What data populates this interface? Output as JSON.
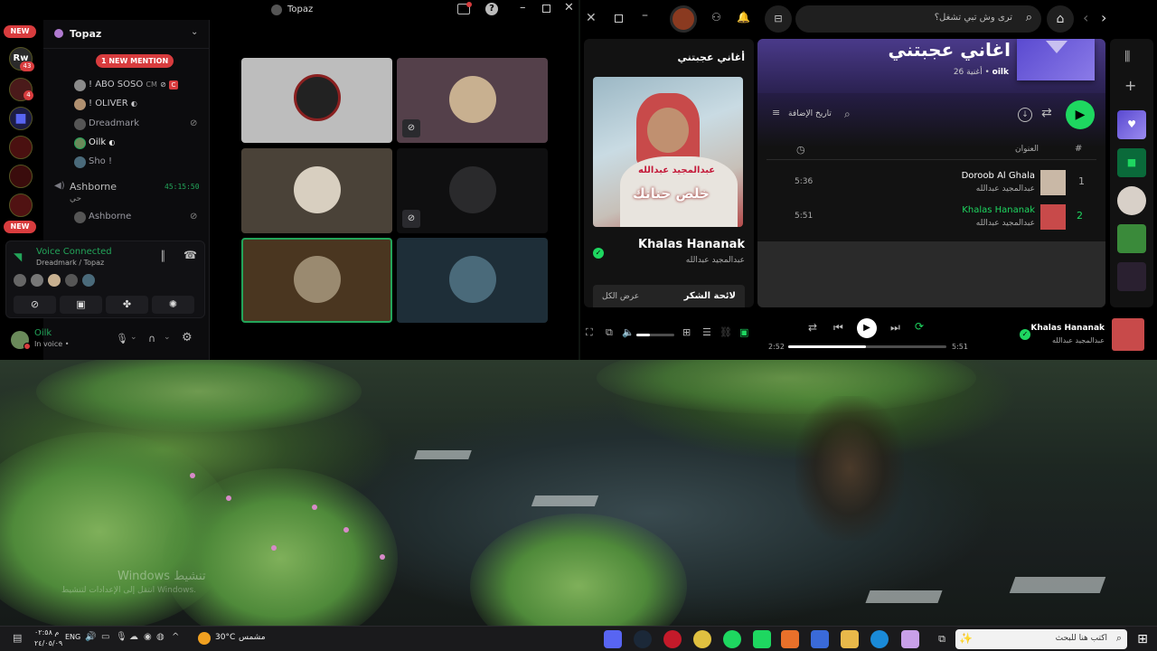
{
  "discord": {
    "window_title": "Topaz",
    "guild_new_badge": "NEW",
    "guild_rw_label": "Rw",
    "guild_badge_count_1": "43",
    "guild_badge_count_2": "4",
    "new_mention": "1 NEW MENTION",
    "server_name": "Topaz",
    "users": [
      {
        "name": "! ABO SOSO",
        "tag": "CM"
      },
      {
        "name": "! OLIVER"
      },
      {
        "name": "Dreadmark"
      },
      {
        "name": "Oilk"
      },
      {
        "name": "Sho !"
      }
    ],
    "channel_name": "Ashborne",
    "channel_timer": "45:15:50",
    "channel_sub": "حي",
    "channel_user": "Ashborne",
    "voice_status": "Voice Connected",
    "voice_location": "Dreadmark / Topaz",
    "self_name": "Oilk",
    "self_status": "In voice •"
  },
  "spotify": {
    "search_placeholder": "ترى وش تبي تشغل؟",
    "playlist_title": "اغاني عجبتني",
    "playlist_meta_owner": "oilk",
    "playlist_meta_count": "26 أغنية",
    "sort_label": "تاريخ الإضافة",
    "col_title": "العنوان",
    "col_num": "#",
    "tracks": [
      {
        "num": "1",
        "title": "Doroob Al Ghala",
        "artist": "عبدالمجيد عبدالله",
        "duration": "5:36"
      },
      {
        "num": "2",
        "title": "Khalas Hananak",
        "artist": "عبدالمجيد عبدالله",
        "duration": "5:51"
      }
    ],
    "np_panel_title": "أغاني عجبتني",
    "np_title": "Khalas Hananak",
    "np_artist": "عبدالمجيد عبدالله",
    "album_art_text": "خلص حنانك",
    "album_art_name": "عبدالمجيد عبدالله",
    "credits_label": "لائحة الشكر",
    "show_all": "عرض الكل",
    "player_title": "Khalas Hananak",
    "player_artist": "عبدالمجيد عبدالله",
    "time_elapsed": "2:52",
    "time_total": "5:51",
    "progress": 0.49,
    "volume": 0.35,
    "accent": "#1ed760"
  },
  "desktop": {
    "watermark_1": "Windows تنشيط",
    "watermark_2": "انتقل إلى الإعدادات لتنشيط Windows."
  },
  "taskbar": {
    "search_placeholder": "اكتب هنا للبحث",
    "weather_temp": "30°C",
    "weather_text": "مشمس",
    "lang": "ENG",
    "clock_time": "م ٠٢:٥٨",
    "clock_date": "٢٤/٠٥/٠٩"
  }
}
